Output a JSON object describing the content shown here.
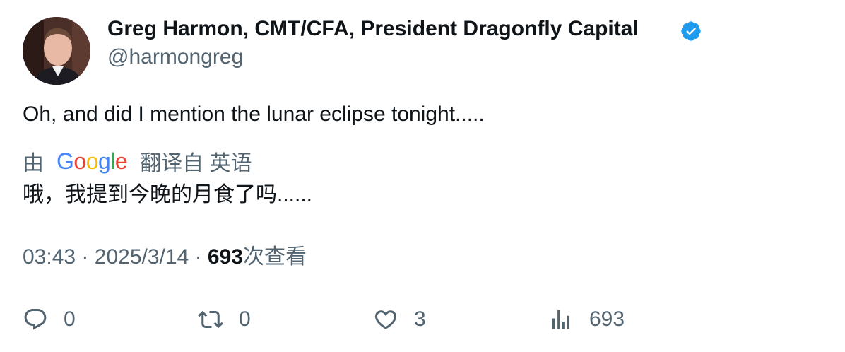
{
  "author": {
    "name": "Greg Harmon, CMT/CFA, President Dragonfly Capital",
    "handle": "@harmongreg",
    "verified_color": "#1d9bf0"
  },
  "tweet": {
    "text": "Oh, and did I mention the lunar eclipse tonight.....",
    "translation": {
      "prefix": "由",
      "provider_letters": [
        "G",
        "o",
        "o",
        "g",
        "l",
        "e"
      ],
      "provider_colors": [
        "#4285F4",
        "#EA4335",
        "#FBBC05",
        "#4285F4",
        "#34A853",
        "#EA4335"
      ],
      "suffix": "翻译自 英语",
      "text": "哦，我提到今晚的月食了吗......"
    }
  },
  "meta": {
    "time": "03:43",
    "separator": "·",
    "date": "2025/3/14",
    "views_count": "693",
    "views_label": "次查看"
  },
  "actions": {
    "replies": "0",
    "retweets": "0",
    "likes": "3",
    "views": "693"
  }
}
